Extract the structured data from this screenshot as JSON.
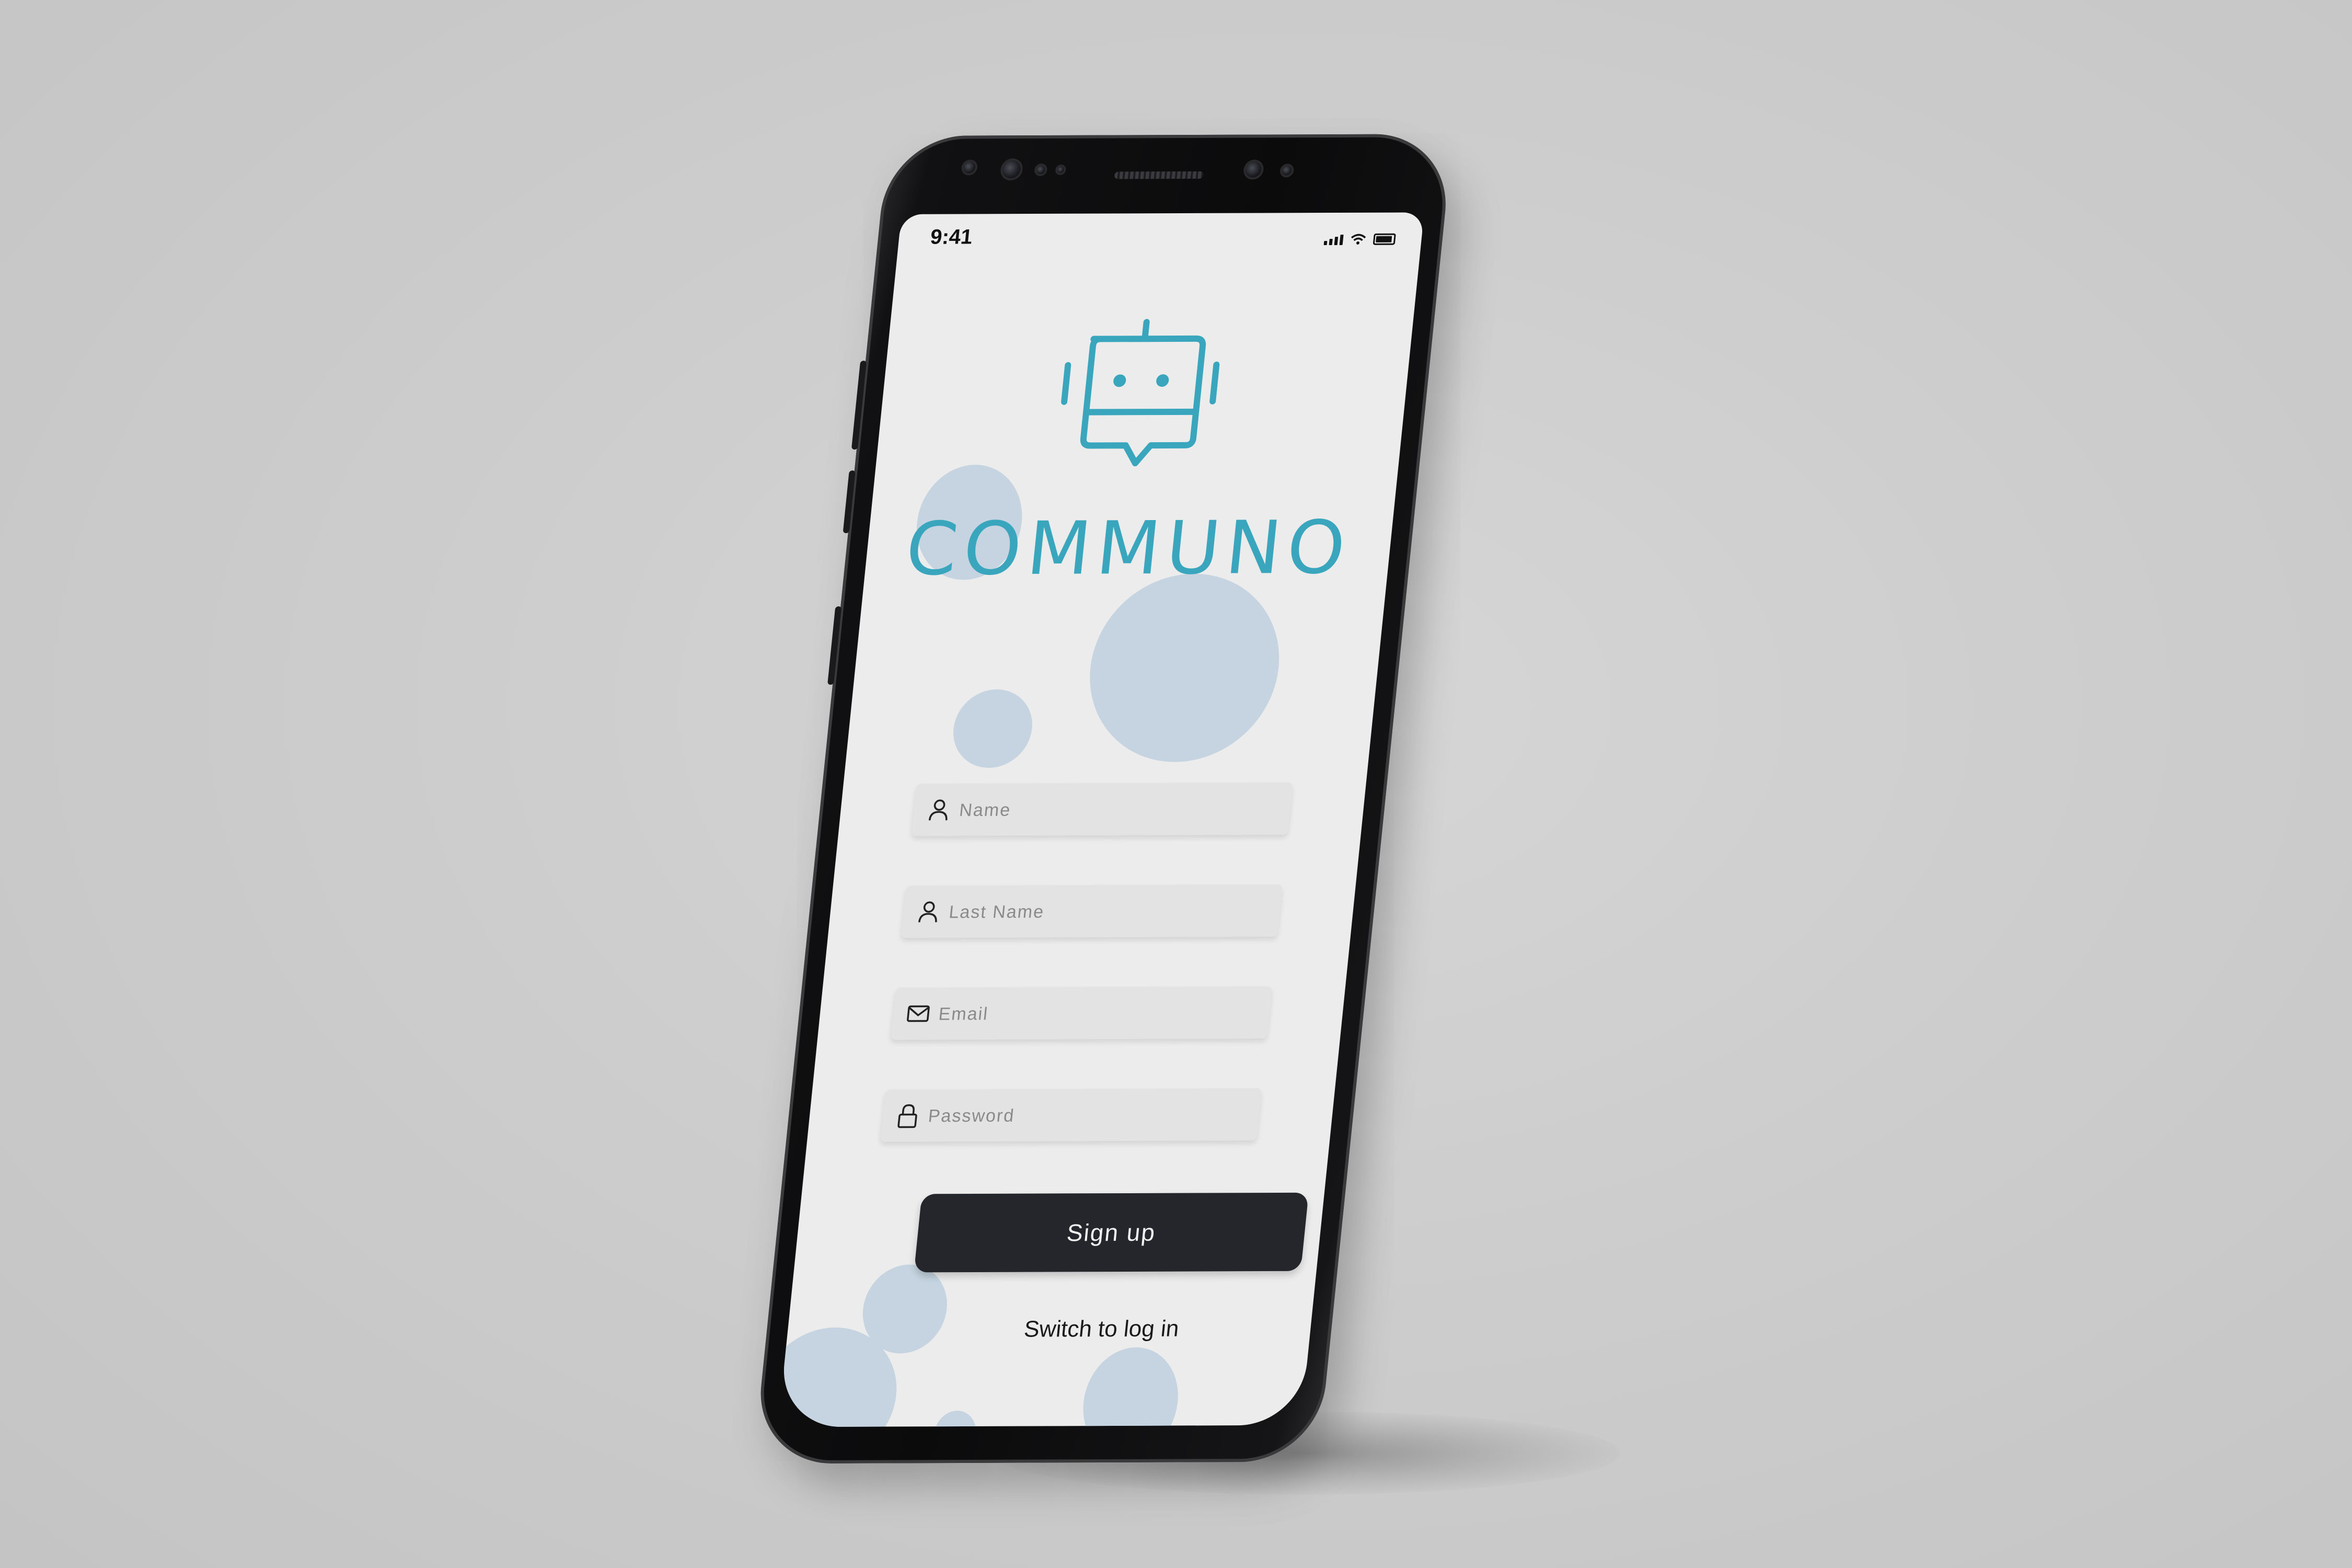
{
  "status_bar": {
    "time": "9:41"
  },
  "app": {
    "name": "COMMUNO",
    "logo_icon": "robot-chat-icon",
    "accent_color": "#3aa6be"
  },
  "form": {
    "name_placeholder": "Name",
    "last_name_placeholder": "Last Name",
    "email_placeholder": "Email",
    "password_placeholder": "Password",
    "submit_label": "Sign up",
    "switch_label": "Switch to log in"
  },
  "icons": {
    "name": "user-icon",
    "last_name": "user-icon",
    "email": "mail-icon",
    "password": "lock-icon"
  },
  "colors": {
    "screen_background": "#ececec",
    "button_background": "#24262b",
    "blob": "#c5d4e0"
  }
}
